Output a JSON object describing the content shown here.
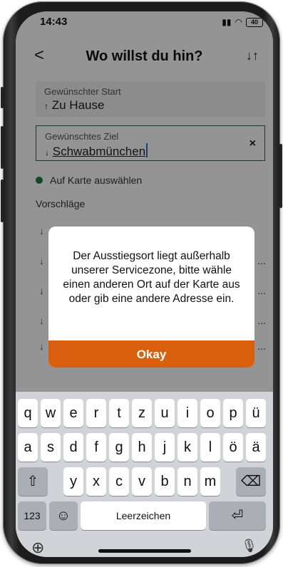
{
  "status": {
    "time": "14:43",
    "battery": "40"
  },
  "nav": {
    "back": "<",
    "title": "Wo willst du hin?",
    "swap": "↓↑"
  },
  "start": {
    "label": "Gewünschter Start",
    "value": "Zu Hause",
    "arrow": "↑"
  },
  "destination": {
    "label": "Gewünschtes Ziel",
    "value": "Schwabmünchen",
    "arrow": "↓",
    "clear": "×"
  },
  "map_pick": "Auf Karte auswählen",
  "suggestions": {
    "title": "Vorschläge",
    "arrow": "↓",
    "ellipsis": "..."
  },
  "dialog": {
    "message": "Der Ausstiegsort liegt außerhalb unserer Servicezone, bitte wähle einen anderen Ort auf der Karte aus oder gib eine andere Adresse ein.",
    "ok": "Okay"
  },
  "keyboard": {
    "row1": [
      "q",
      "w",
      "e",
      "r",
      "t",
      "z",
      "u",
      "i",
      "o",
      "p",
      "ü"
    ],
    "row2": [
      "a",
      "s",
      "d",
      "f",
      "g",
      "h",
      "j",
      "k",
      "l",
      "ö",
      "ä"
    ],
    "row3": [
      "y",
      "x",
      "c",
      "v",
      "b",
      "n",
      "m"
    ],
    "numbers": "123",
    "space": "Leerzeichen",
    "shift": "⇧",
    "delete": "⌫",
    "return": "⏎",
    "emoji": "☺",
    "globe": "⊕",
    "mic": "🎙"
  },
  "colors": {
    "accent": "#d95f0f",
    "green": "#1f7a3b"
  }
}
